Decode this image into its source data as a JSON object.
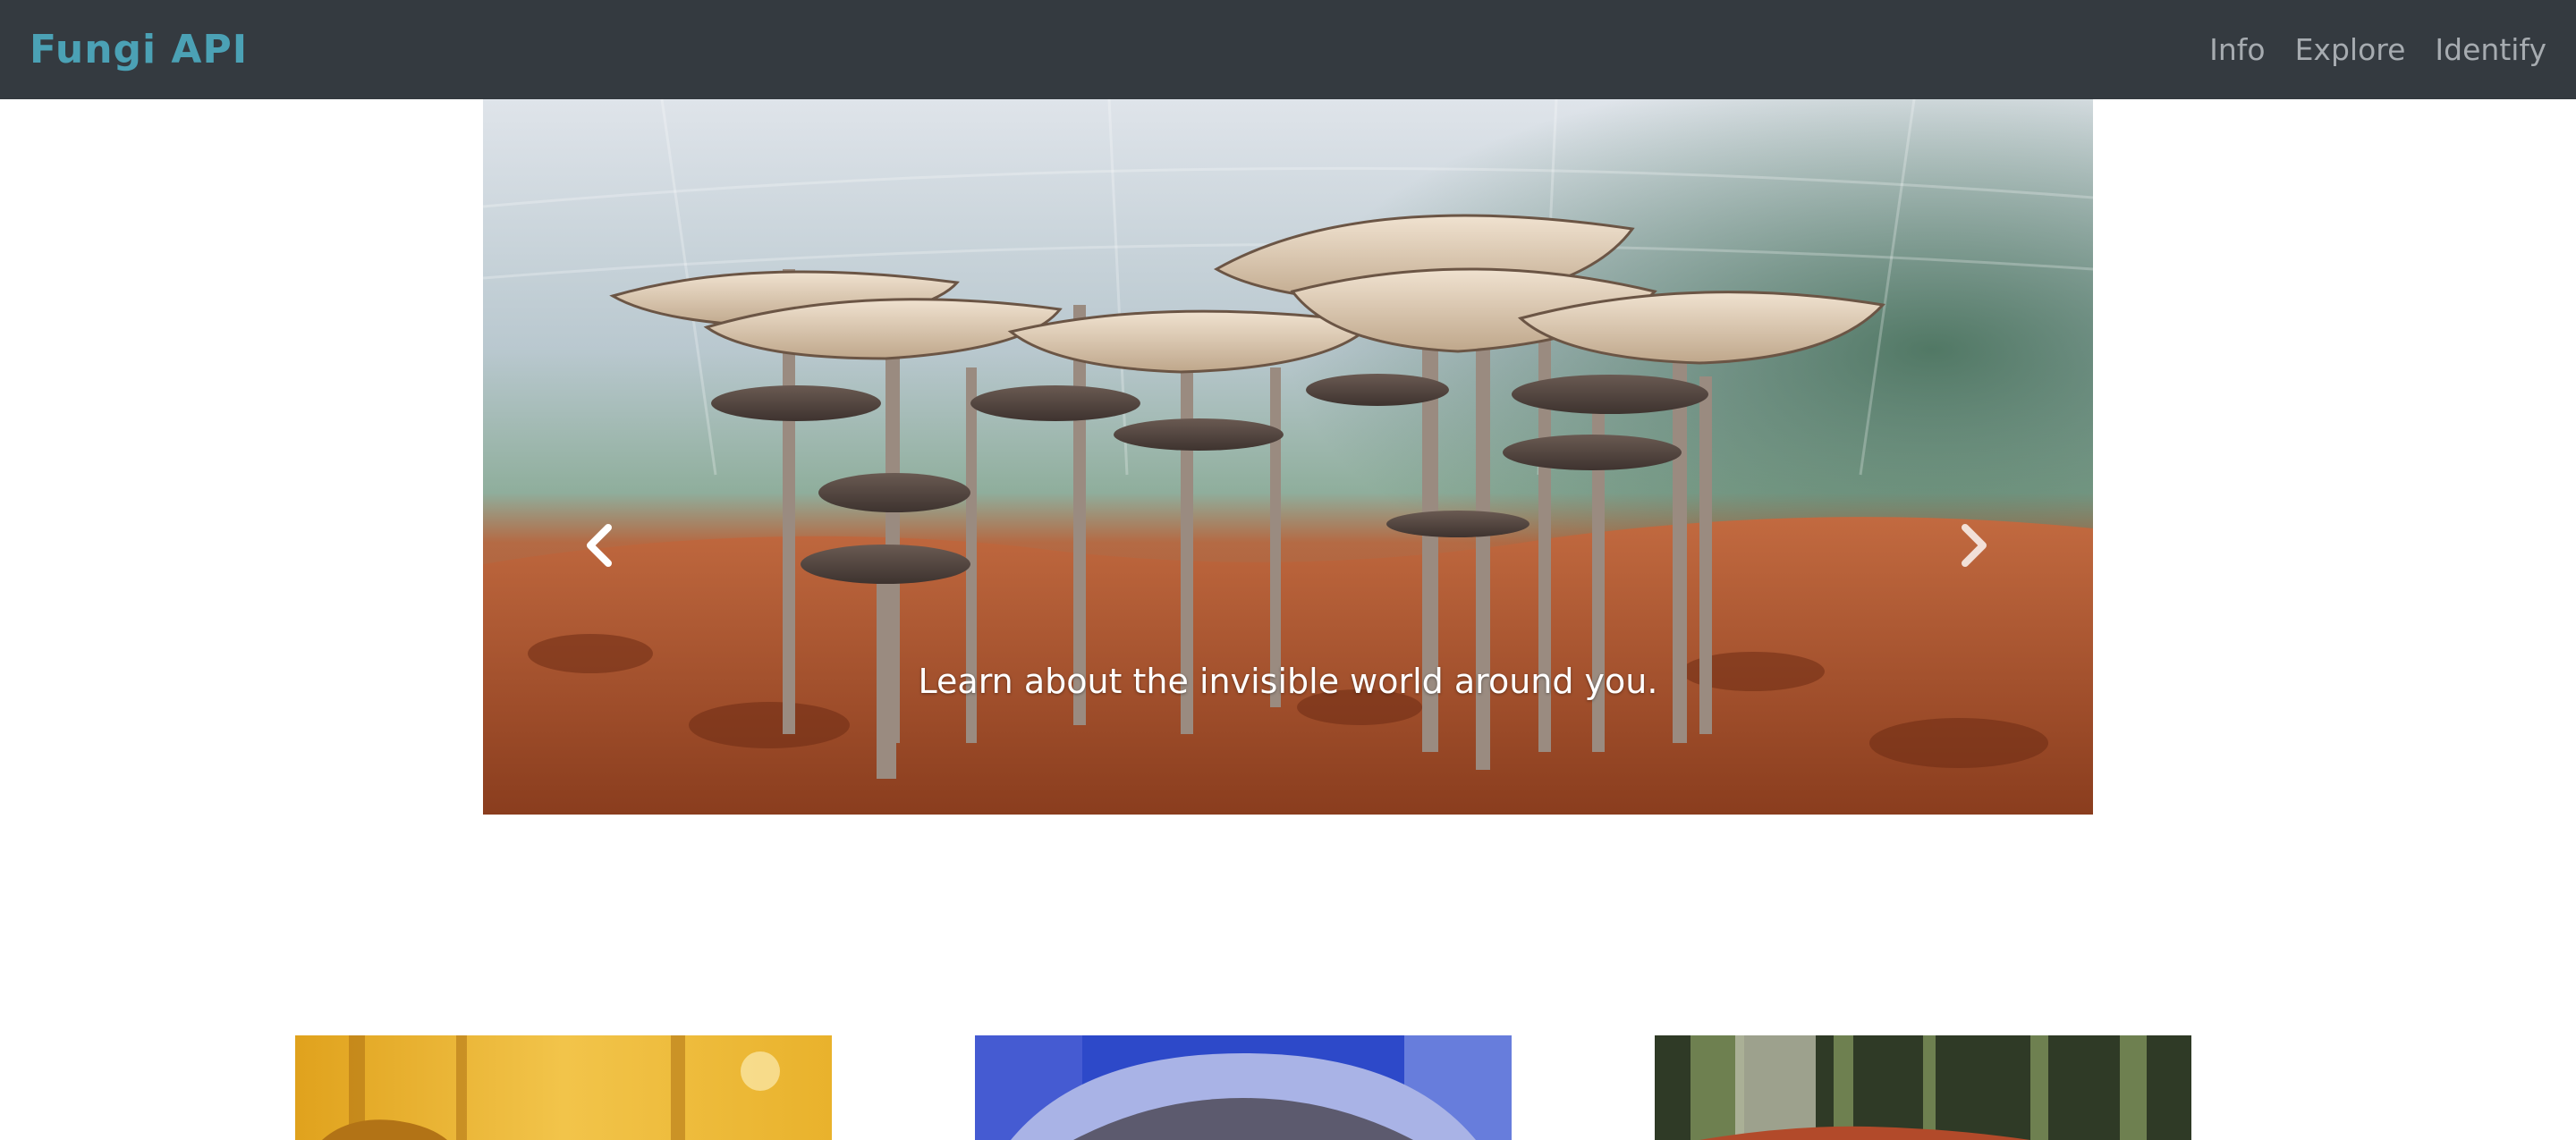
{
  "navbar": {
    "brand": "Fungi API",
    "links": [
      {
        "label": "Info"
      },
      {
        "label": "Explore"
      },
      {
        "label": "Identify"
      }
    ]
  },
  "carousel": {
    "caption": "Learn about the invisible world around you.",
    "prev_icon": "chevron-left-icon",
    "next_icon": "chevron-right-icon"
  },
  "cards": [
    {
      "image": "autumn-mushroom-photo"
    },
    {
      "image": "blue-mushroom-photo"
    },
    {
      "image": "forest-mushroom-photo"
    }
  ],
  "colors": {
    "navbar_bg": "#343a40",
    "brand": "#4ba1b5",
    "nav_link": "#a6abb0"
  }
}
